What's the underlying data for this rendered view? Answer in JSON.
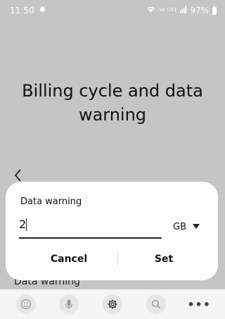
{
  "status_bar": {
    "time": "11:50",
    "network": "Vo) LTE1",
    "battery_percent": "97%",
    "icons": [
      "snapchat-ghost-icon",
      "wifi-icon",
      "signal-icon",
      "battery-icon"
    ]
  },
  "page": {
    "title": "Billing cycle and data warning",
    "background_row_label": "Data warning"
  },
  "dialog": {
    "title": "Data warning",
    "input_value": "2",
    "unit_selected": "GB",
    "cancel_label": "Cancel",
    "set_label": "Set"
  },
  "keyboard_toolbar": {
    "keys": [
      "emoji-icon",
      "microphone-icon",
      "settings-gear-icon",
      "search-icon",
      "more-icon"
    ],
    "more_label": "•••"
  },
  "colors": {
    "scrim": "#c5c5c5",
    "dialog_bg": "#fdfdfd",
    "text": "#111111"
  }
}
